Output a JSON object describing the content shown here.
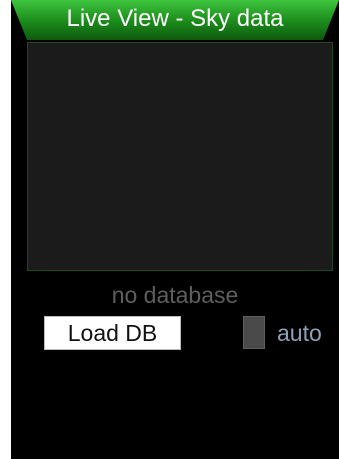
{
  "header": {
    "title": "Live View - Sky data"
  },
  "sky_view": {
    "status": "no database"
  },
  "controls": {
    "load_label": "Load DB",
    "auto_label": "auto"
  },
  "colors": {
    "title_bar_green": "#1d8f1d",
    "background": "#000000",
    "view_fill": "#1b1b1b"
  }
}
